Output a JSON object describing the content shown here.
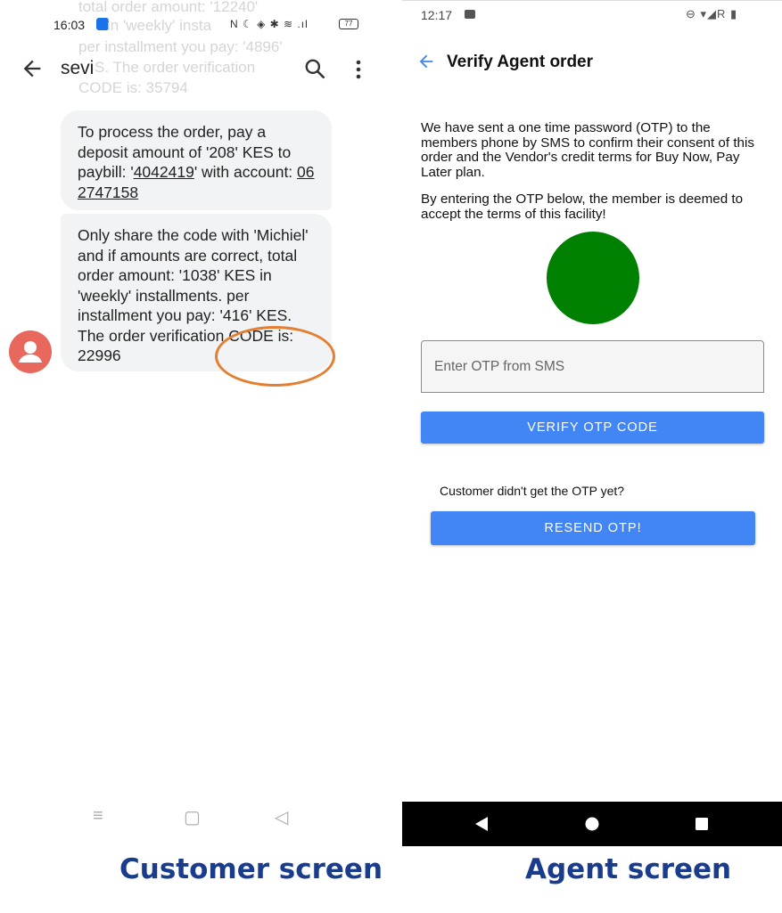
{
  "customer_phone": {
    "status_bar": {
      "time": "16:03",
      "system_icons": "N ☾ ◈ ✱ ≋ .ıl",
      "battery": "77"
    },
    "background_ghost_lines": [
      "total order amount: '12240'",
      "in 'weekly' insta",
      "per installment you pay: '4896'",
      "S. The order verification",
      "CODE is: 35794"
    ],
    "header": {
      "contact_name": "sevi",
      "back_icon": "arrow-left-icon",
      "search_icon": "search-icon",
      "more_icon": "more-vertical-icon"
    },
    "messages": [
      {
        "text_before": "To process the order, pay a deposit amount of '208' KES to paybill: '",
        "paybill": "4042419",
        "text_mid": "' with account: ",
        "account": "06 2747158"
      },
      {
        "text": "Only share the code with 'Michiel' and if amounts are correct, total order amount: '1038' KES in 'weekly' installments. per installment you pay: '416' KES. The order verification CODE is: 22996"
      }
    ],
    "highlight_color": "#e47f32",
    "avatar_color": "#e8685e",
    "nav": {
      "menu": "≡",
      "home": "▢",
      "back": "◁"
    }
  },
  "agent_phone": {
    "status_bar": {
      "time": "12:17",
      "system_icons": "⊖ ▾◢R ▮"
    },
    "appbar": {
      "title": "Verify Agent order",
      "back_icon": "arrow-left-icon"
    },
    "paragraph_1": "We have sent a one time password (OTP) to the members phone by SMS to confirm their consent of this order and the Vendor's credit terms for Buy Now, Pay Later plan.",
    "paragraph_2": "By entering the OTP below, the member is deemed to accept the terms of this facility!",
    "status_circle_color": "#008000",
    "otp_input": {
      "placeholder": "Enter OTP from SMS",
      "value": ""
    },
    "verify_button": "VERIFY OTP CODE",
    "resend_prompt": "Customer didn't get the OTP yet?",
    "resend_button": "RESEND OTP!",
    "accent_color": "#4285f4"
  },
  "captions": {
    "left": "Customer screen",
    "right": "Agent screen",
    "color": "#1a3c8c"
  }
}
